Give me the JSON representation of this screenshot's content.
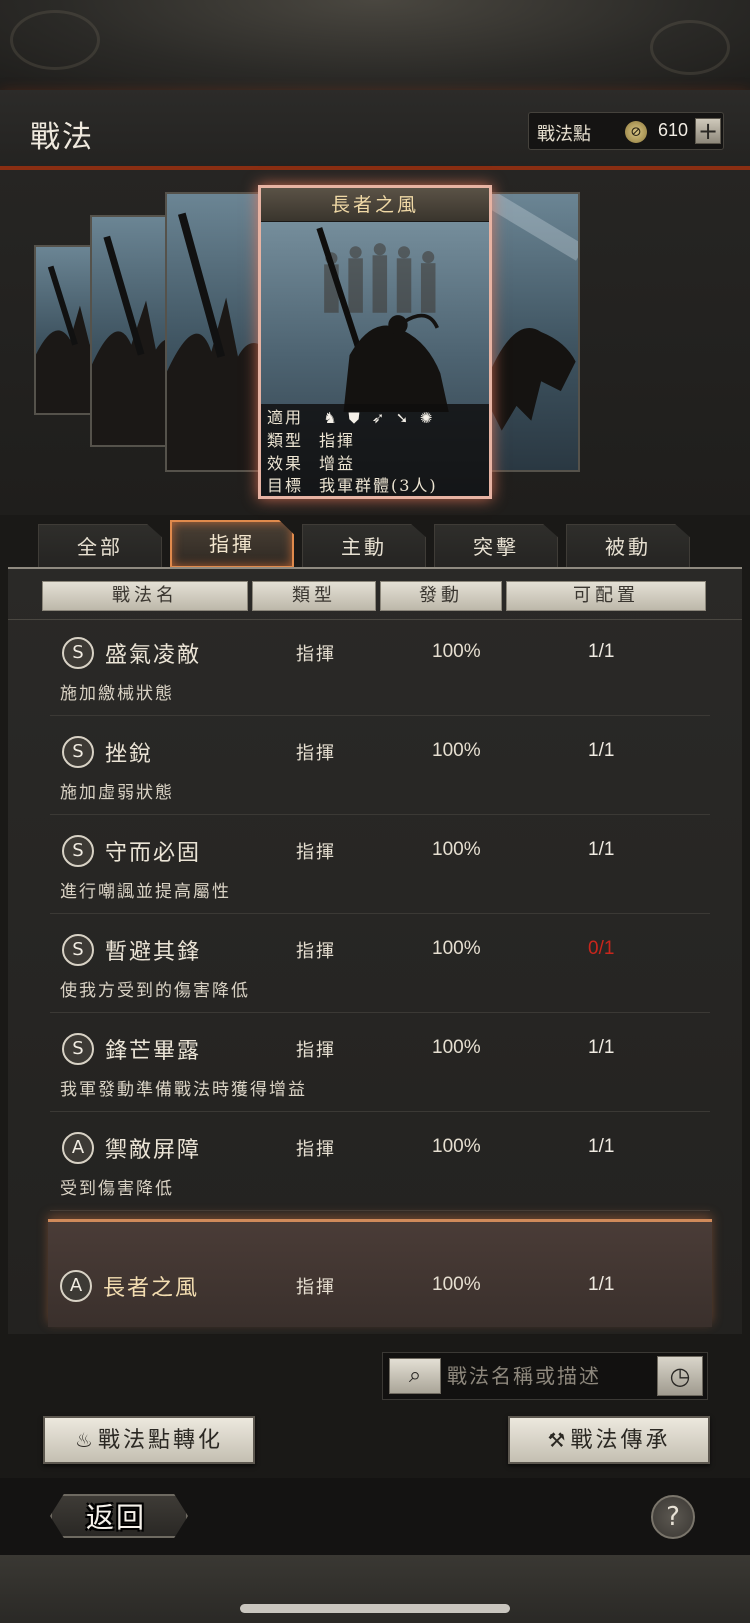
{
  "header": {
    "title": "戰法",
    "points_label": "戰法點",
    "points_icon": "tactic-point-icon",
    "points_value": "610",
    "plus_label": "+"
  },
  "card": {
    "name": "長者之風",
    "rows": {
      "applicable_label": "適用",
      "applicable_icons": [
        "cavalry-icon",
        "shield-icon",
        "archer-icon",
        "spear-icon",
        "chariot-icon"
      ],
      "type_label": "類型",
      "type_value": "指揮",
      "effect_label": "效果",
      "effect_value": "增益",
      "target_label": "目標",
      "target_value": "我軍群體(3人)"
    }
  },
  "tabs": [
    "全部",
    "指揮",
    "主動",
    "突擊",
    "被動"
  ],
  "active_tab": 1,
  "columns": [
    "戰法名",
    "類型",
    "發動",
    "可配置"
  ],
  "rows": [
    {
      "grade": "S",
      "name": "盛氣凌敵",
      "type": "指揮",
      "rate": "100%",
      "count": "1/1",
      "desc": "施加繳械狀態"
    },
    {
      "grade": "S",
      "name": "挫銳",
      "type": "指揮",
      "rate": "100%",
      "count": "1/1",
      "desc": "施加虛弱狀態"
    },
    {
      "grade": "S",
      "name": "守而必固",
      "type": "指揮",
      "rate": "100%",
      "count": "1/1",
      "desc": "進行嘲諷並提高屬性"
    },
    {
      "grade": "S",
      "name": "暫避其鋒",
      "type": "指揮",
      "rate": "100%",
      "count": "0/1",
      "desc": "使我方受到的傷害降低"
    },
    {
      "grade": "S",
      "name": "鋒芒畢露",
      "type": "指揮",
      "rate": "100%",
      "count": "1/1",
      "desc": "我軍發動準備戰法時獲得增益"
    },
    {
      "grade": "A",
      "name": "禦敵屏障",
      "type": "指揮",
      "rate": "100%",
      "count": "1/1",
      "desc": "受到傷害降低"
    }
  ],
  "selected_row": {
    "grade": "A",
    "name": "長者之風",
    "type": "指揮",
    "rate": "100%",
    "count": "1/1"
  },
  "search": {
    "placeholder": "戰法名稱或描述",
    "value": ""
  },
  "buttons": {
    "convert": "戰法點轉化",
    "convert_icon": "flame-icon",
    "inherit": "戰法傳承",
    "inherit_icon": "hammer-icon"
  },
  "footer": {
    "back": "返回",
    "help": "?"
  },
  "colors": {
    "accent": "#e08a4c",
    "warning": "#c8261c",
    "header_line": "#8a2e12"
  }
}
